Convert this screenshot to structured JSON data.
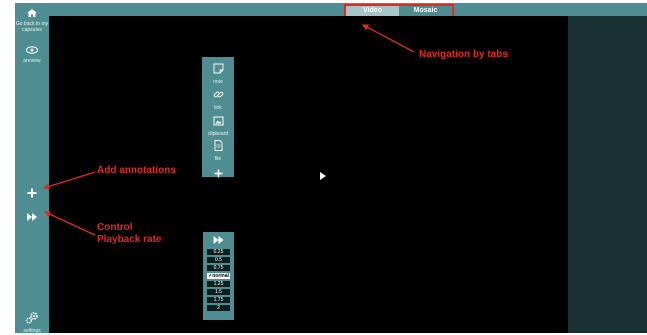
{
  "sidebar": {
    "back_label": "Go back to my capsules",
    "preview_label": "preview",
    "settings_label": "settings"
  },
  "tabs": [
    {
      "label": "Video",
      "active": true
    },
    {
      "label": "Mosaic",
      "active": false
    }
  ],
  "annotation_panel": {
    "items": [
      {
        "icon": "note-icon",
        "label": "note"
      },
      {
        "icon": "link-icon",
        "label": "link"
      },
      {
        "icon": "clipboard-icon",
        "label": "clipboard"
      },
      {
        "icon": "file-icon",
        "label": "file"
      }
    ]
  },
  "playback_rate": {
    "options": [
      "0.25",
      "0.5",
      "0.75",
      "✓normal",
      "1.25",
      "1.5",
      "1.75",
      "2"
    ],
    "selected": "✓normal"
  },
  "callouts": {
    "tabs": "Navigation by tabs",
    "annotations": "Add annotations",
    "rate_line1": "Control",
    "rate_line2": "Playback rate"
  },
  "colors": {
    "teal": "#4e8e92",
    "dark_panel": "#1b3234",
    "callout_red": "#e02a1f"
  }
}
